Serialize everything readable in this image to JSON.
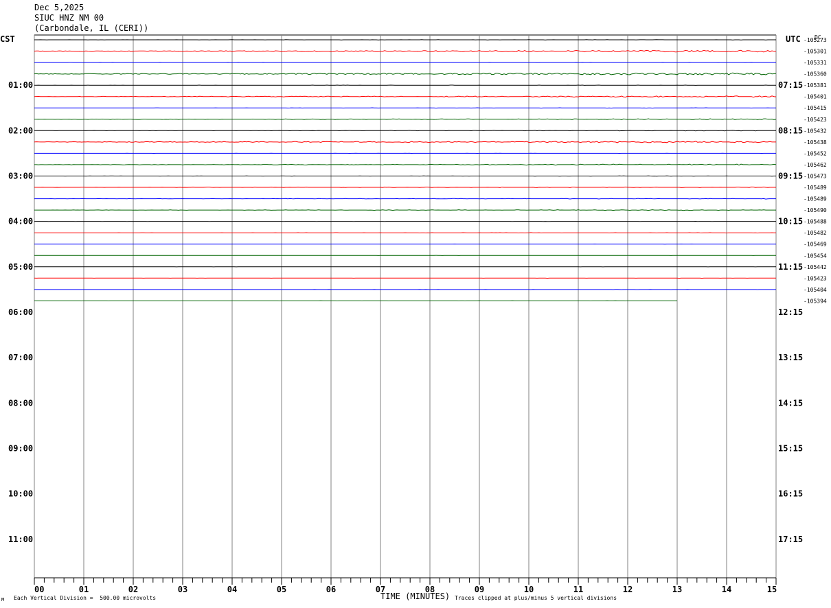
{
  "header": {
    "date": "Dec 5,2025",
    "station": "SIUC HNZ NM 00",
    "location": "(Carbondale, IL (CERI))"
  },
  "labels": {
    "left_zone": "CST",
    "right_zone": "UTC",
    "dc": "DC",
    "xaxis": "TIME (MINUTES)",
    "footer_left": "Each Vertical Division =  500.00 microvolts",
    "footer_right": "Traces clipped at plus/minus 5 vertical divisions",
    "corner_mark": "M"
  },
  "colors": {
    "trace_cycle": [
      "#000000",
      "#ff0000",
      "#0000ff",
      "#006400"
    ],
    "grid": "#808080",
    "background": "#ffffff"
  },
  "chart_data": {
    "type": "line",
    "title": "SIUC HNZ NM 00",
    "xlabel": "TIME (MINUTES)",
    "xlim": [
      0,
      15
    ],
    "x_ticks": [
      "00",
      "01",
      "02",
      "03",
      "04",
      "05",
      "06",
      "07",
      "08",
      "09",
      "10",
      "11",
      "12",
      "13",
      "14",
      "15"
    ],
    "left_hour_labels": [
      "01:00",
      "02:00",
      "03:00",
      "04:00",
      "05:00",
      "06:00",
      "07:00",
      "08:00",
      "09:00",
      "10:00",
      "11:00"
    ],
    "right_hour_labels": [
      "07:15",
      "08:15",
      "09:15",
      "10:15",
      "11:15",
      "12:15",
      "13:15",
      "14:15",
      "15:15",
      "16:15",
      "17:15"
    ],
    "total_rows": 48,
    "dc_offsets": [
      "-105273",
      "-105301",
      "-105331",
      "-105360",
      "-105381",
      "-105401",
      "-105415",
      "-105423",
      "-105432",
      "-105438",
      "-105452",
      "-105462",
      "-105473",
      "-105489",
      "-105489",
      "-105490",
      "-105488",
      "-105482",
      "-105469",
      "-105454",
      "-105442",
      "-105423",
      "-105404",
      "-105394"
    ],
    "last_trace_end_minute": 13,
    "trace_activity": [
      0.2,
      0.8,
      0.1,
      0.9,
      0.2,
      0.6,
      0.2,
      0.5,
      0.3,
      0.7,
      0.1,
      0.5,
      0.2,
      0.3,
      0.3,
      0.4,
      0.1,
      0.2,
      0.1,
      0.1,
      0.1,
      0.1,
      0.1,
      0.1
    ]
  }
}
